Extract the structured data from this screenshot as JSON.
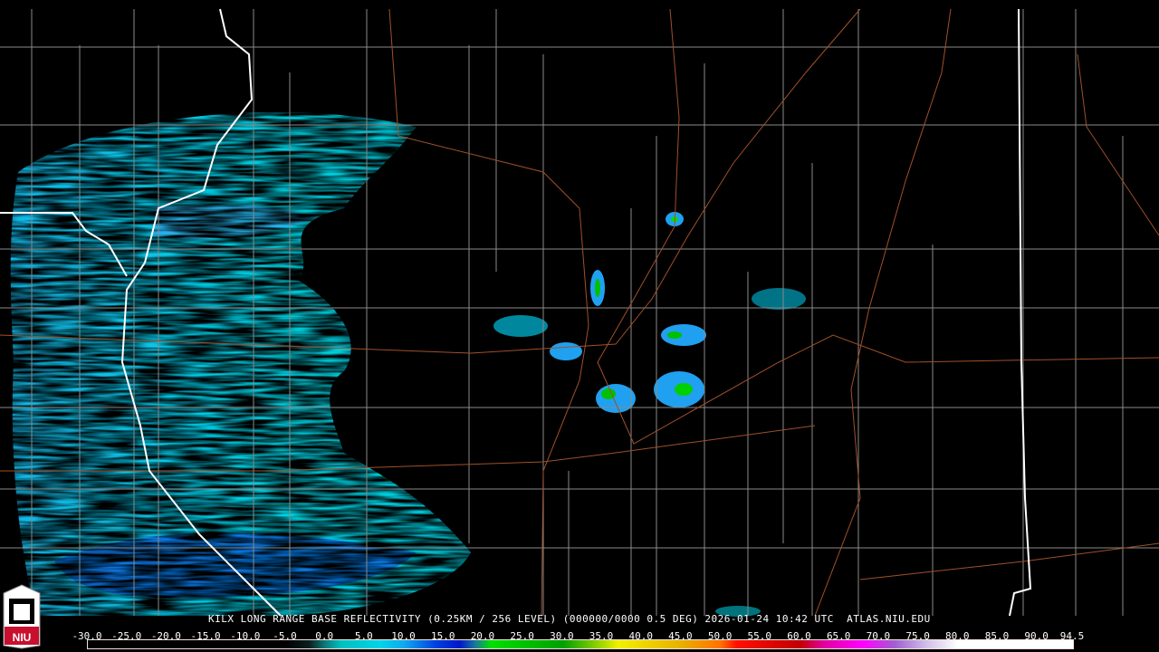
{
  "product": {
    "title": "KILX LONG RANGE BASE REFLECTIVITY (0.25KM / 256 LEVEL) (000000/0000 0.5 DEG) 2026-01-24 10:42 UTC  ATLAS.NIU.EDU",
    "logo_text": "NIU"
  },
  "legend": {
    "unit_min": -30.0,
    "unit_max": 94.5,
    "ticks": [
      "-30.0",
      "-25.0",
      "-20.0",
      "-15.0",
      "-10.0",
      "-5.0",
      "0.0",
      "5.0",
      "10.0",
      "15.0",
      "20.0",
      "25.0",
      "30.0",
      "35.0",
      "40.0",
      "45.0",
      "50.0",
      "55.0",
      "60.0",
      "65.0",
      "70.0",
      "75.0",
      "80.0",
      "85.0",
      "90.0",
      "94.5"
    ],
    "colors": [
      {
        "dbz": -30,
        "hex": "#000000"
      },
      {
        "dbz": -5,
        "hex": "#000000"
      },
      {
        "dbz": -2,
        "hex": "#0a2020"
      },
      {
        "dbz": 0,
        "hex": "#0e7a7a"
      },
      {
        "dbz": 2,
        "hex": "#00c0c0"
      },
      {
        "dbz": 7,
        "hex": "#00d4e8"
      },
      {
        "dbz": 10,
        "hex": "#10a8f0"
      },
      {
        "dbz": 14,
        "hex": "#0040e0"
      },
      {
        "dbz": 17,
        "hex": "#0018c8"
      },
      {
        "dbz": 19,
        "hex": "#1a7a9a"
      },
      {
        "dbz": 21,
        "hex": "#00e000"
      },
      {
        "dbz": 30,
        "hex": "#00a000"
      },
      {
        "dbz": 34,
        "hex": "#80cc00"
      },
      {
        "dbz": 37,
        "hex": "#f0f000"
      },
      {
        "dbz": 45,
        "hex": "#e8b000"
      },
      {
        "dbz": 50,
        "hex": "#ff7000"
      },
      {
        "dbz": 52,
        "hex": "#ff1000"
      },
      {
        "dbz": 60,
        "hex": "#c00000"
      },
      {
        "dbz": 63,
        "hex": "#e000a0"
      },
      {
        "dbz": 68,
        "hex": "#ff00ff"
      },
      {
        "dbz": 72,
        "hex": "#a060d0"
      },
      {
        "dbz": 76,
        "hex": "#d0c0e8"
      },
      {
        "dbz": 80,
        "hex": "#ffffff"
      },
      {
        "dbz": 94.5,
        "hex": "#ffffff"
      }
    ]
  },
  "colors": {
    "county": "#8a8a8a",
    "state": "#ffffff",
    "road": "#a0502a",
    "echo_light": "#00d0e0",
    "echo_mid": "#20a0f0",
    "echo_heavy": "#0030e0"
  }
}
